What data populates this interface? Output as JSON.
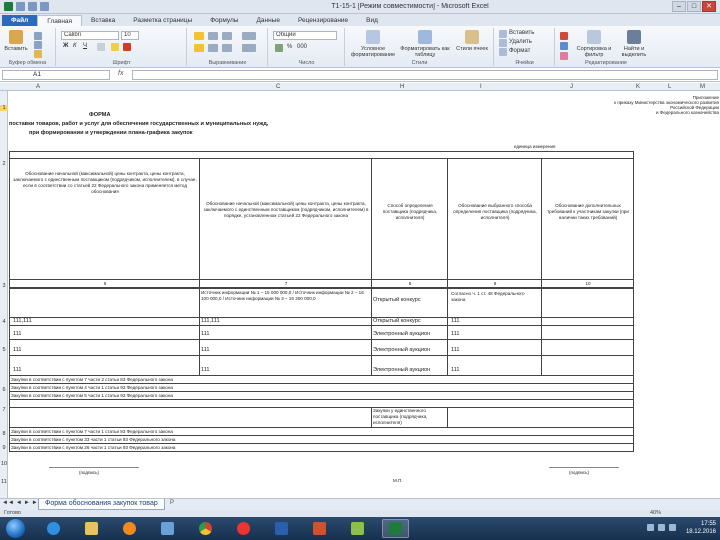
{
  "window": {
    "title": "Т1-15-1 [Режим совместимости] - Microsoft Excel",
    "controls": [
      "–",
      "□",
      "✕"
    ]
  },
  "ribbon_tabs": [
    "Файл",
    "Главная",
    "Вставка",
    "Разметка страницы",
    "Формулы",
    "Данные",
    "Рецензирование",
    "Вид"
  ],
  "ribbon": {
    "paste_label": "Вставить",
    "clipboard_group": "Буфер обмена",
    "font_name": "Calibri",
    "font_size": "10",
    "font_group": "Шрифт",
    "align_group": "Выравнивание",
    "number_format": "Общий",
    "number_group": "Число",
    "cond_format": "Условное форматирование",
    "format_table": "Форматировать как таблицу",
    "cell_styles": "Стили ячеек",
    "styles_group": "Стили",
    "insert_btn": "Вставить",
    "delete_btn": "Удалить",
    "format_btn": "Формат",
    "cells_group": "Ячейки",
    "sort_btn": "Сортировка и фильтр",
    "find_btn": "Найти и выделить",
    "edit_group": "Редактирование"
  },
  "formula_bar": {
    "name_box": "A1",
    "fx": "fx",
    "value": ""
  },
  "columns": [
    "A",
    "C",
    "H",
    "I",
    "J",
    "K",
    "L",
    "M"
  ],
  "rows": [
    "1",
    "2",
    "3",
    "4",
    "5",
    "6",
    "7",
    "8",
    "9",
    "10",
    "11"
  ],
  "sheet": {
    "top_right": [
      "Приложение",
      "к приказу Министерства экономического развития",
      "Российской Федерации",
      "и Федерального казначейства"
    ],
    "form_title": "ФОРМА",
    "subtitle_1": "поставки товаров, работ и услуг для обеспечения государственных и муниципальных нужд,",
    "subtitle_2": "при формировании и утверждении плана-графика закупок",
    "units": "единица измерения",
    "col6_header": "Обоснование начальной (максимальной) цены контракта, цены контракта, заключаемого с единственным поставщиком (подрядчиком, исполнителем), в случае, если в соответствии со статьей 22 Федерального закона применяется метод обоснования",
    "col7_header": "Обоснование начальной (максимальной) цены контракта, цены контракта, заключаемого с единственным поставщиком (подрядчиком, исполнителем) в порядке, установленном статьей 22 Федерального закона",
    "col8_header": "Способ определения поставщика (подрядчика, исполнителя)",
    "col9_header": "Обоснование выбранного способа определения поставщика (подрядчика, исполнителя)",
    "col10_header": "Обоснование дополнительных требований к участникам закупки (при наличии таких требований)",
    "col_nums": [
      "6",
      "7",
      "8",
      "9",
      "10"
    ],
    "r1_c7": "Источник информации № 1 – 15 000 000,0 / Источник информации № 2 – 16 100 000,0 / Источник информации № 3 – 16 300 000,0",
    "r1_c8": "Открытый конкурс",
    "r1_c9": "Согласно ч. 1 ст. 48 Федерального закона",
    "r2_c6": "111,111",
    "r2_c7": "111,111",
    "r2_c8": "Открытый конкурс",
    "r2_c9": "111",
    "r3_c6": "111",
    "r3_c7": "111",
    "r3_c8": "Электронный аукцион",
    "r3_c9": "111",
    "r4_c6": "111",
    "r4_c7": "111",
    "r4_c8": "Электронный аукцион",
    "r4_c9": "111",
    "r5_c6": "111",
    "r5_c7": "111",
    "r5_c8": "Электронный аукцион",
    "r5_c9": "111",
    "footer_rows": [
      "Закупки в соответствии с пунктом 7 части 2 статьи 83 Федерального закона",
      "Закупки в соответствии с пунктом 4 части 1 статьи 93 Федерального закона",
      "Закупки в соответствии с пунктом 5 части 1 статьи 93 Федерального закона",
      "Закупки в соответствии с пунктом 7 части 1 статьи 93 Федерального закона",
      "Закупки в соответствии с пунктом 33 части 1 статьи 93 Федерального закона",
      "Закупки в соответствии с пунктом 26 части 1 статьи 93 Федерального закона"
    ],
    "footer_c8": "Закупки у единственного поставщика (подрядчика, исполнителя)",
    "signature_left": "(подпись)",
    "signature_right": "(подпись)",
    "mp": "М.П."
  },
  "sheet_tabs": {
    "active": "Форма обоснования закупок товар",
    "other": "Р",
    "nav": [
      "◄◄",
      "◄",
      "►",
      "►►"
    ]
  },
  "status": {
    "ready": "Готово",
    "zoom": "40%"
  },
  "taskbar": {
    "time": "17:55",
    "date": "18.12.2016"
  },
  "colors": {
    "file_tab": "#2a6bbd",
    "excel_green": "#1f7a3d",
    "selected_row": "#f7d36b"
  }
}
